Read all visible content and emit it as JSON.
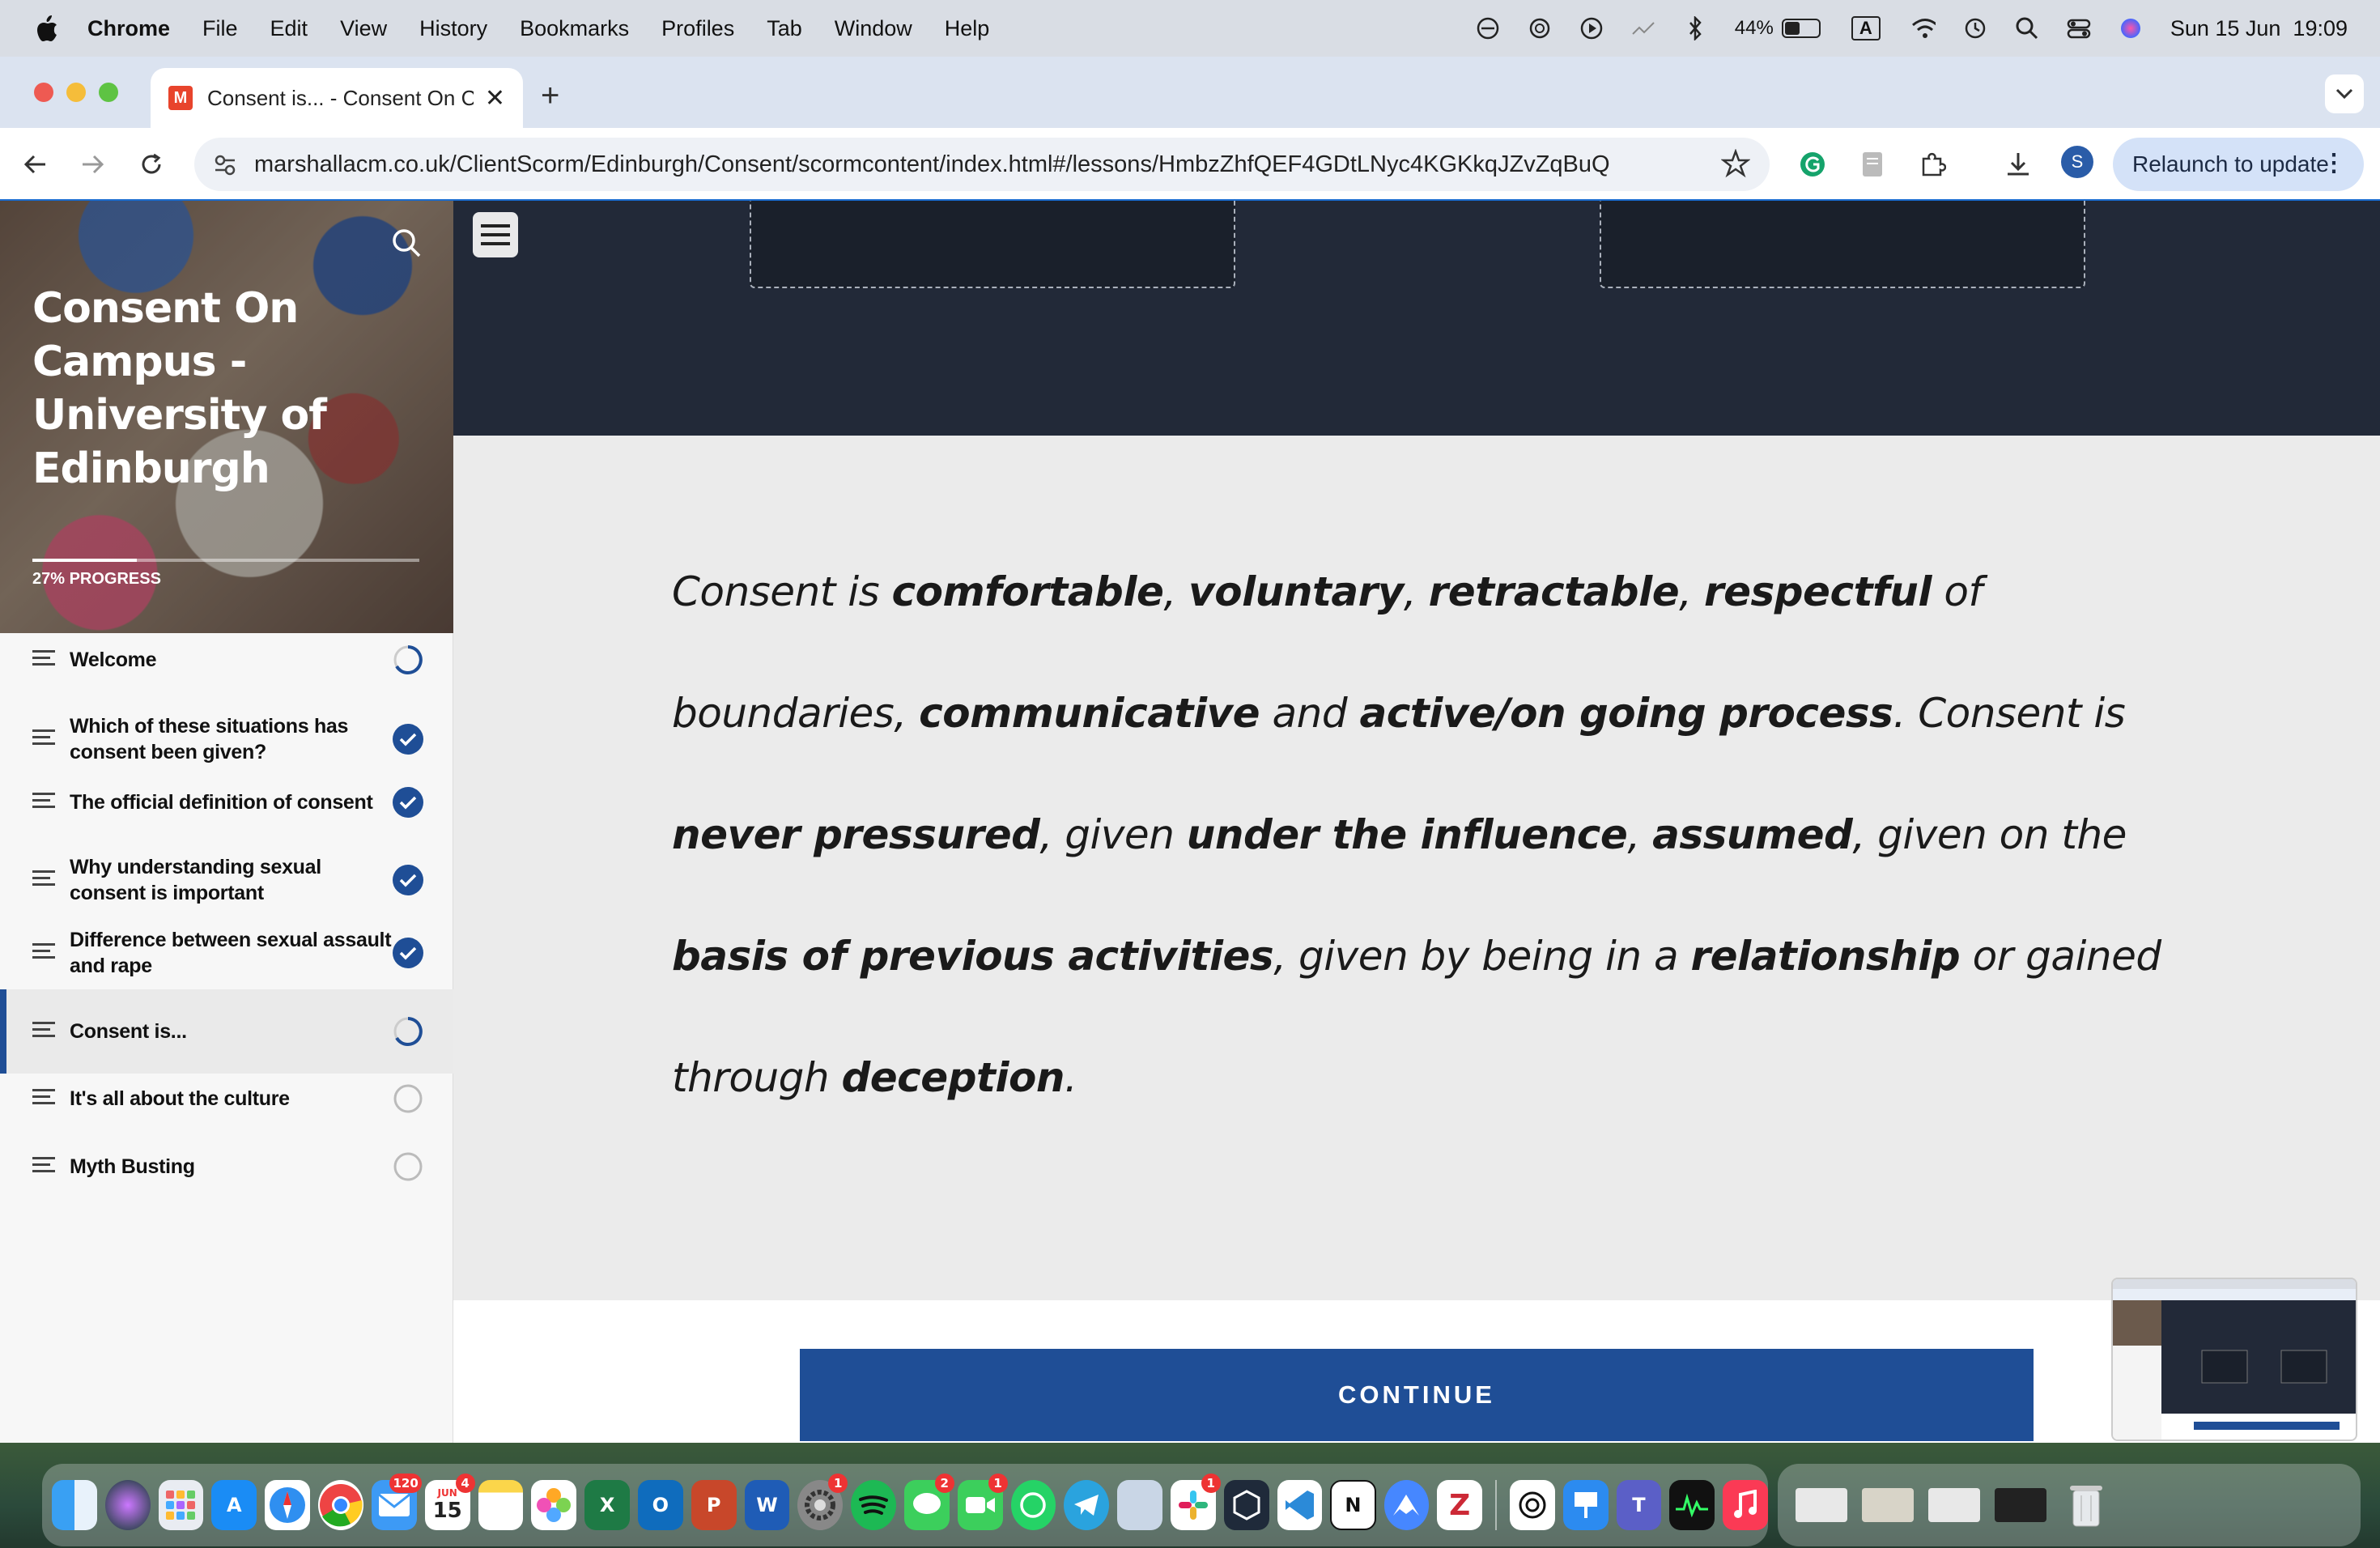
{
  "menubar": {
    "app": "Chrome",
    "items": [
      "File",
      "Edit",
      "View",
      "History",
      "Bookmarks",
      "Profiles",
      "Tab",
      "Window",
      "Help"
    ],
    "battery": "44%",
    "input_source": "A",
    "datetime": "Sun 15 Jun  19:09"
  },
  "browser": {
    "tab_title": "Consent is... - Consent On Campus - University of Edinburgh",
    "tab_favicon": "M",
    "url": "marshallacm.co.uk/ClientScorm/Edinburgh/Consent/scormcontent/index.html#/lessons/HmbzZhfQEF4GDtLNyc4KGKkqJZvZqBuQ",
    "profile_initial": "S",
    "relaunch_label": "Relaunch to update"
  },
  "sidebar": {
    "course_title": "Consent On Campus - University of Edinburgh",
    "progress_label": "27% PROGRESS",
    "progress_value": 0.27,
    "lessons": [
      {
        "label": "Welcome",
        "status": "in-progress"
      },
      {
        "label": "Which of these situations has consent been given?",
        "status": "complete"
      },
      {
        "label": "The official definition of consent",
        "status": "complete"
      },
      {
        "label": "Why understanding sexual consent is important",
        "status": "complete"
      },
      {
        "label": "Difference between sexual assault and rape",
        "status": "complete"
      },
      {
        "label": "Consent is...",
        "status": "in-progress",
        "active": true
      },
      {
        "label": "It's all about the culture",
        "status": "not-started"
      },
      {
        "label": "Myth Busting",
        "status": "not-started"
      }
    ]
  },
  "main": {
    "quote_segments": [
      {
        "t": "Consent is ",
        "b": false
      },
      {
        "t": "comfortable",
        "b": true
      },
      {
        "t": ", ",
        "b": false
      },
      {
        "t": "voluntary",
        "b": true
      },
      {
        "t": ", ",
        "b": false
      },
      {
        "t": "retractable",
        "b": true
      },
      {
        "t": ", ",
        "b": false
      },
      {
        "t": "respectful",
        "b": true
      },
      {
        "t": " of boundaries, ",
        "b": false
      },
      {
        "t": "communicative",
        "b": true
      },
      {
        "t": " and ",
        "b": false
      },
      {
        "t": "active/on going process",
        "b": true
      },
      {
        "t": ". Consent is ",
        "b": false
      },
      {
        "t": "never pressured",
        "b": true
      },
      {
        "t": ", given ",
        "b": false
      },
      {
        "t": "under the influence",
        "b": true
      },
      {
        "t": ", ",
        "b": false
      },
      {
        "t": "assumed",
        "b": true
      },
      {
        "t": ", given on the ",
        "b": false
      },
      {
        "t": "basis of previous activities",
        "b": true
      },
      {
        "t": ", given by being in a ",
        "b": false
      },
      {
        "t": "relationship",
        "b": true
      },
      {
        "t": " or gained through ",
        "b": false
      },
      {
        "t": "deception",
        "b": true
      },
      {
        "t": ".",
        "b": false
      }
    ],
    "continue_label": "CONTINUE"
  },
  "dock": {
    "badges": {
      "mail": "120",
      "calendar": "4",
      "settings": "1",
      "messages": "2",
      "facetime": "1",
      "slack": "1"
    },
    "calendar_month": "JUN",
    "calendar_day": "15"
  },
  "colors": {
    "accent": "#1f4e96",
    "dark_band": "#222938",
    "quote_bg": "#ebebeb"
  }
}
